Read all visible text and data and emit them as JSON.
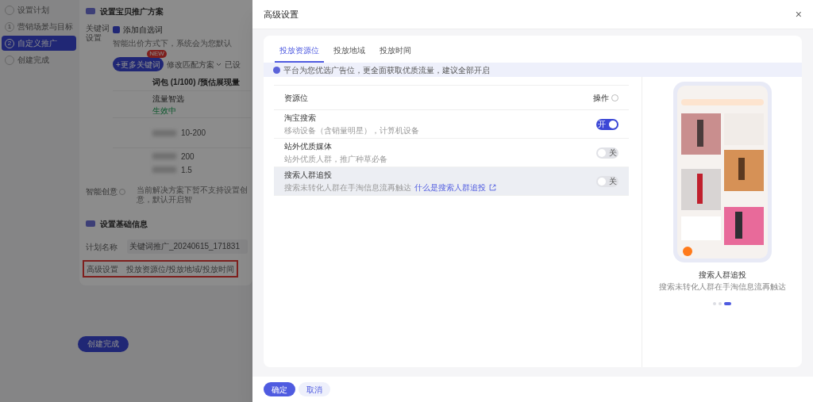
{
  "background_page": {
    "steps": [
      {
        "label": "设置计划",
        "selected": false
      },
      {
        "number": "1",
        "label": "营销场景与目标",
        "selected": false
      },
      {
        "number": "2",
        "label": "自定义推广",
        "selected": true
      },
      {
        "label": "创建完成",
        "selected": false
      }
    ],
    "plan_section": {
      "title": "设置宝贝推广方案",
      "keyword_label": "关键词设置",
      "custom_words": {
        "label": "添加自选词",
        "checked": true
      },
      "note": "智能出价方式下，系统会为您默认",
      "more_keywords_button": "+更多关键词",
      "new_badge": "NEW",
      "match_dropdown": "修改匹配方案",
      "column_3": "已设",
      "table_header": "词包 (1/100) /预估展现量",
      "rows": [
        {
          "name": "流量智选",
          "status": "生效中"
        },
        {
          "value": "10-200"
        },
        {
          "value": "200",
          "extra": "1.5"
        }
      ],
      "creative_label": "智能创意",
      "creative_note": "当前解决方案下暂不支持设置创意，默认开启智"
    },
    "basic_section": {
      "title": "设置基础信息",
      "plan_name_label": "计划名称",
      "plan_name": "关键词推广_20240615_171831",
      "advanced_label": "高级设置",
      "advanced_value": "投放资源位/投放地域/投放时间"
    },
    "create_button": "创建完成"
  },
  "drawer": {
    "title": "高级设置",
    "close": "×",
    "tabs": [
      {
        "label": "投放资源位",
        "selected": true
      },
      {
        "label": "投放地域",
        "selected": false
      },
      {
        "label": "投放时间",
        "selected": false
      }
    ],
    "notice": "平台为您优选广告位，更全面获取优质流量，建议全部开启",
    "table": {
      "columns": [
        "资源位",
        "操作"
      ],
      "rows": [
        {
          "name": "淘宝搜索",
          "desc": "移动设备（含销量明星），计算机设备",
          "on": true,
          "switch_text": "开",
          "highlighted": false
        },
        {
          "name": "站外优质媒体",
          "desc": "站外优质人群，推广种草必备",
          "on": false,
          "switch_text": "关",
          "highlighted": false
        },
        {
          "name": "搜索人群追投",
          "desc": "搜索未转化人群在手淘信息流再触达",
          "link": "什么是搜索人群追投",
          "on": false,
          "switch_text": "关",
          "highlighted": true
        }
      ]
    },
    "preview": {
      "kind": "picture",
      "caption": "搜索人群追投",
      "subcaption": "搜索未转化人群在手淘信息流再触达",
      "dots": [
        {
          "selected": false
        },
        {
          "selected": false
        },
        {
          "selected": true
        }
      ]
    },
    "buttons": [
      {
        "label": "确定",
        "kind": "primary"
      },
      {
        "label": "取消",
        "kind": "secondary"
      }
    ]
  }
}
